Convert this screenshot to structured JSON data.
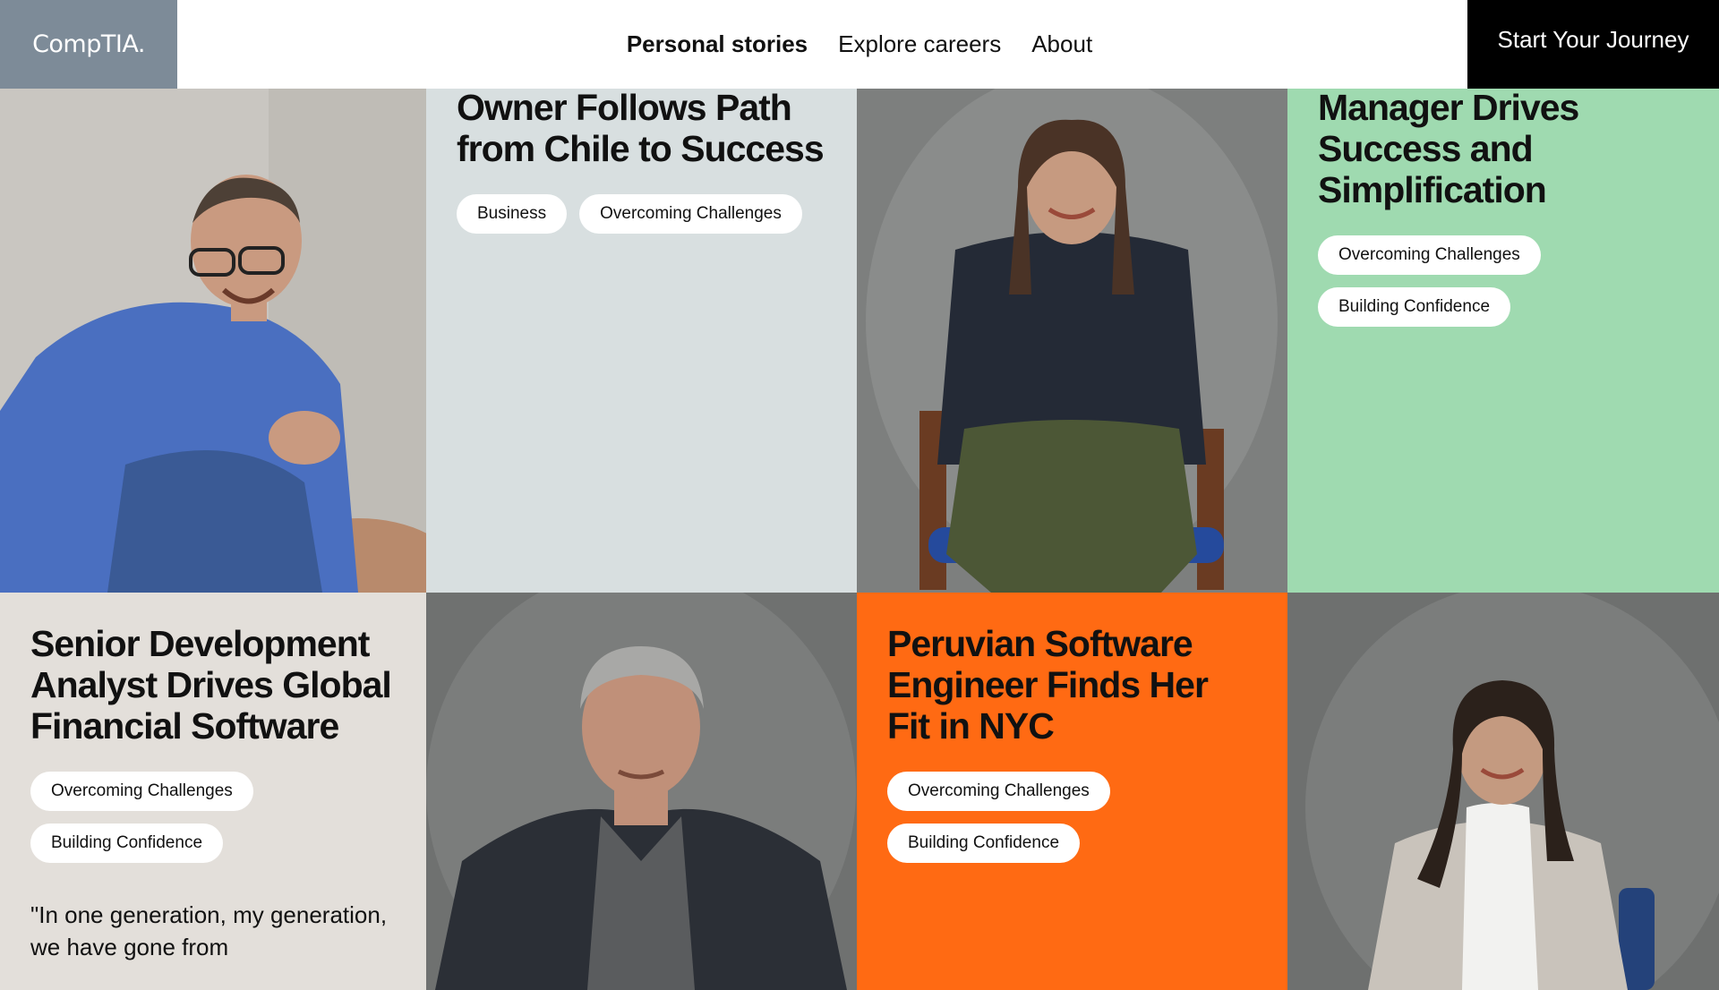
{
  "header": {
    "logo_text": "CompTIA.",
    "nav": [
      {
        "label": "Personal stories",
        "active": true
      },
      {
        "label": "Explore careers",
        "active": false
      },
      {
        "label": "About",
        "active": false
      }
    ],
    "cta_label": "Start Your Journey"
  },
  "stories": [
    {
      "headline": "Owner Follows Path from Chile to Success",
      "tags": [
        "Business",
        "Overcoming Challenges"
      ]
    },
    {
      "headline": "Manager Drives Success and Simplification",
      "tags": [
        "Overcoming Challenges",
        "Building Confidence"
      ]
    },
    {
      "headline": "Senior Development Analyst Drives Global Financial Software",
      "tags": [
        "Overcoming Challenges",
        "Building Confidence"
      ],
      "quote": "\"In one generation, my generation, we have gone from"
    },
    {
      "headline": "Peruvian Software Engineer Finds Her Fit in NYC",
      "tags": [
        "Overcoming Challenges",
        "Building Confidence"
      ]
    }
  ],
  "colors": {
    "logo_bg": "#7d8b98",
    "card_gray_blue": "#d8dfe0",
    "card_green": "#9fdab0",
    "card_beige": "#e3dfda",
    "card_orange": "#ff6a13",
    "cta_bg": "#000000"
  },
  "images": [
    {
      "name": "photo-man-blue-shirt-on-couch"
    },
    {
      "name": "photo-woman-seated-on-chair"
    },
    {
      "name": "photo-man-gray-hair-blazer"
    },
    {
      "name": "photo-woman-white-turtleneck"
    }
  ]
}
